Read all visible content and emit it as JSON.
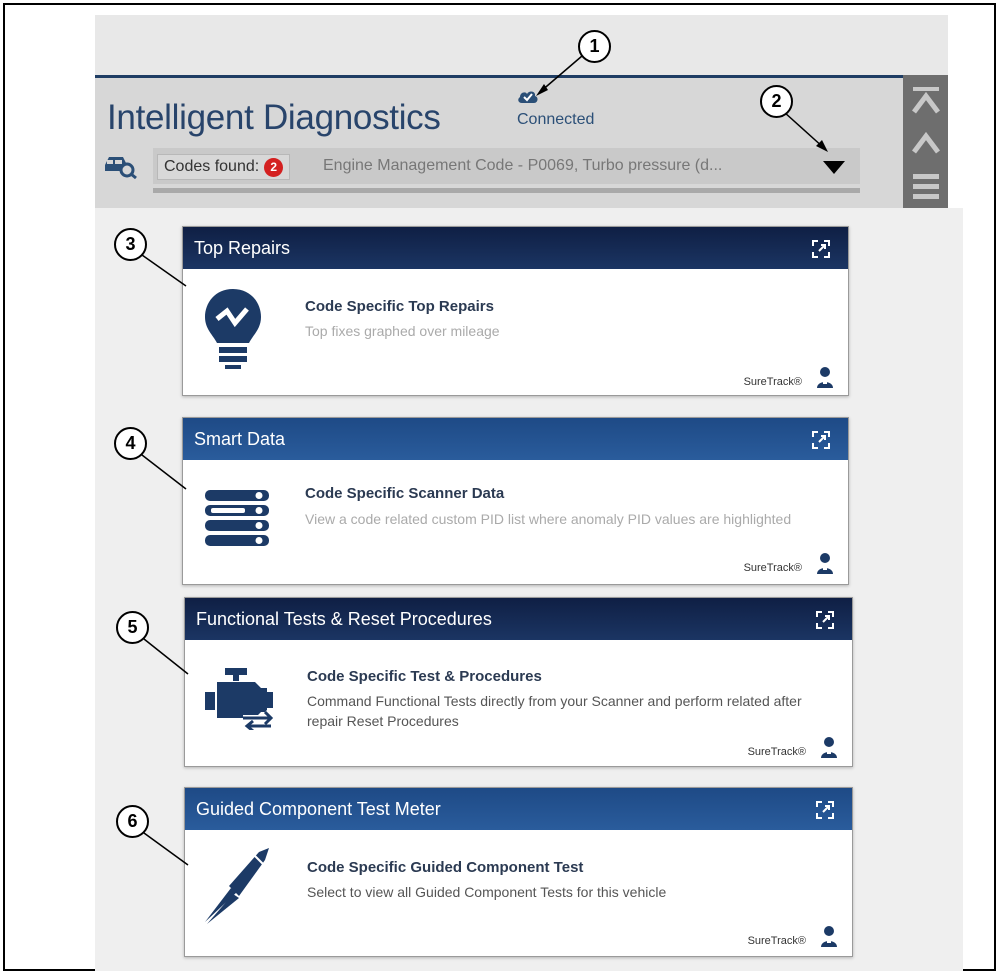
{
  "app": {
    "title": "Intelligent Diagnostics",
    "status": "Connected"
  },
  "codes": {
    "label": "Codes found:",
    "count": "2",
    "selected": "Engine Management Code - P0069, Turbo pressure (d..."
  },
  "cards": [
    {
      "header": "Top Repairs",
      "title": "Code Specific Top Repairs",
      "description": "Top fixes graphed over mileage",
      "brand": "SureTrack®"
    },
    {
      "header": "Smart Data",
      "title": "Code Specific Scanner Data",
      "description": "View a code related custom PID list where anomaly PID values are highlighted",
      "brand": "SureTrack®"
    },
    {
      "header": "Functional Tests & Reset Procedures",
      "title": "Code Specific Test & Procedures",
      "description": "Command Functional Tests directly from your Scanner and perform related after repair Reset Procedures",
      "brand": "SureTrack®"
    },
    {
      "header": "Guided Component Test Meter",
      "title": "Code Specific Guided Component Test",
      "description": "Select to view all Guided Component Tests for this vehicle",
      "brand": "SureTrack®"
    }
  ],
  "callouts": [
    "1",
    "2",
    "3",
    "4",
    "5",
    "6"
  ],
  "colors": {
    "header_dark": "#0f1f44",
    "header_mid": "#2a5c9c",
    "title_blue": "#28446b",
    "badge_red": "#d42020",
    "icon_blue": "#1c3a66"
  },
  "icons": [
    "cloud-check-icon",
    "vehicle-search-icon",
    "dropdown-caret-icon",
    "first-page-icon",
    "page-up-icon",
    "menu-icon",
    "expand-icon",
    "lightbulb-icon",
    "smart-data-icon",
    "engine-icon",
    "test-probe-icon",
    "person-icon"
  ]
}
